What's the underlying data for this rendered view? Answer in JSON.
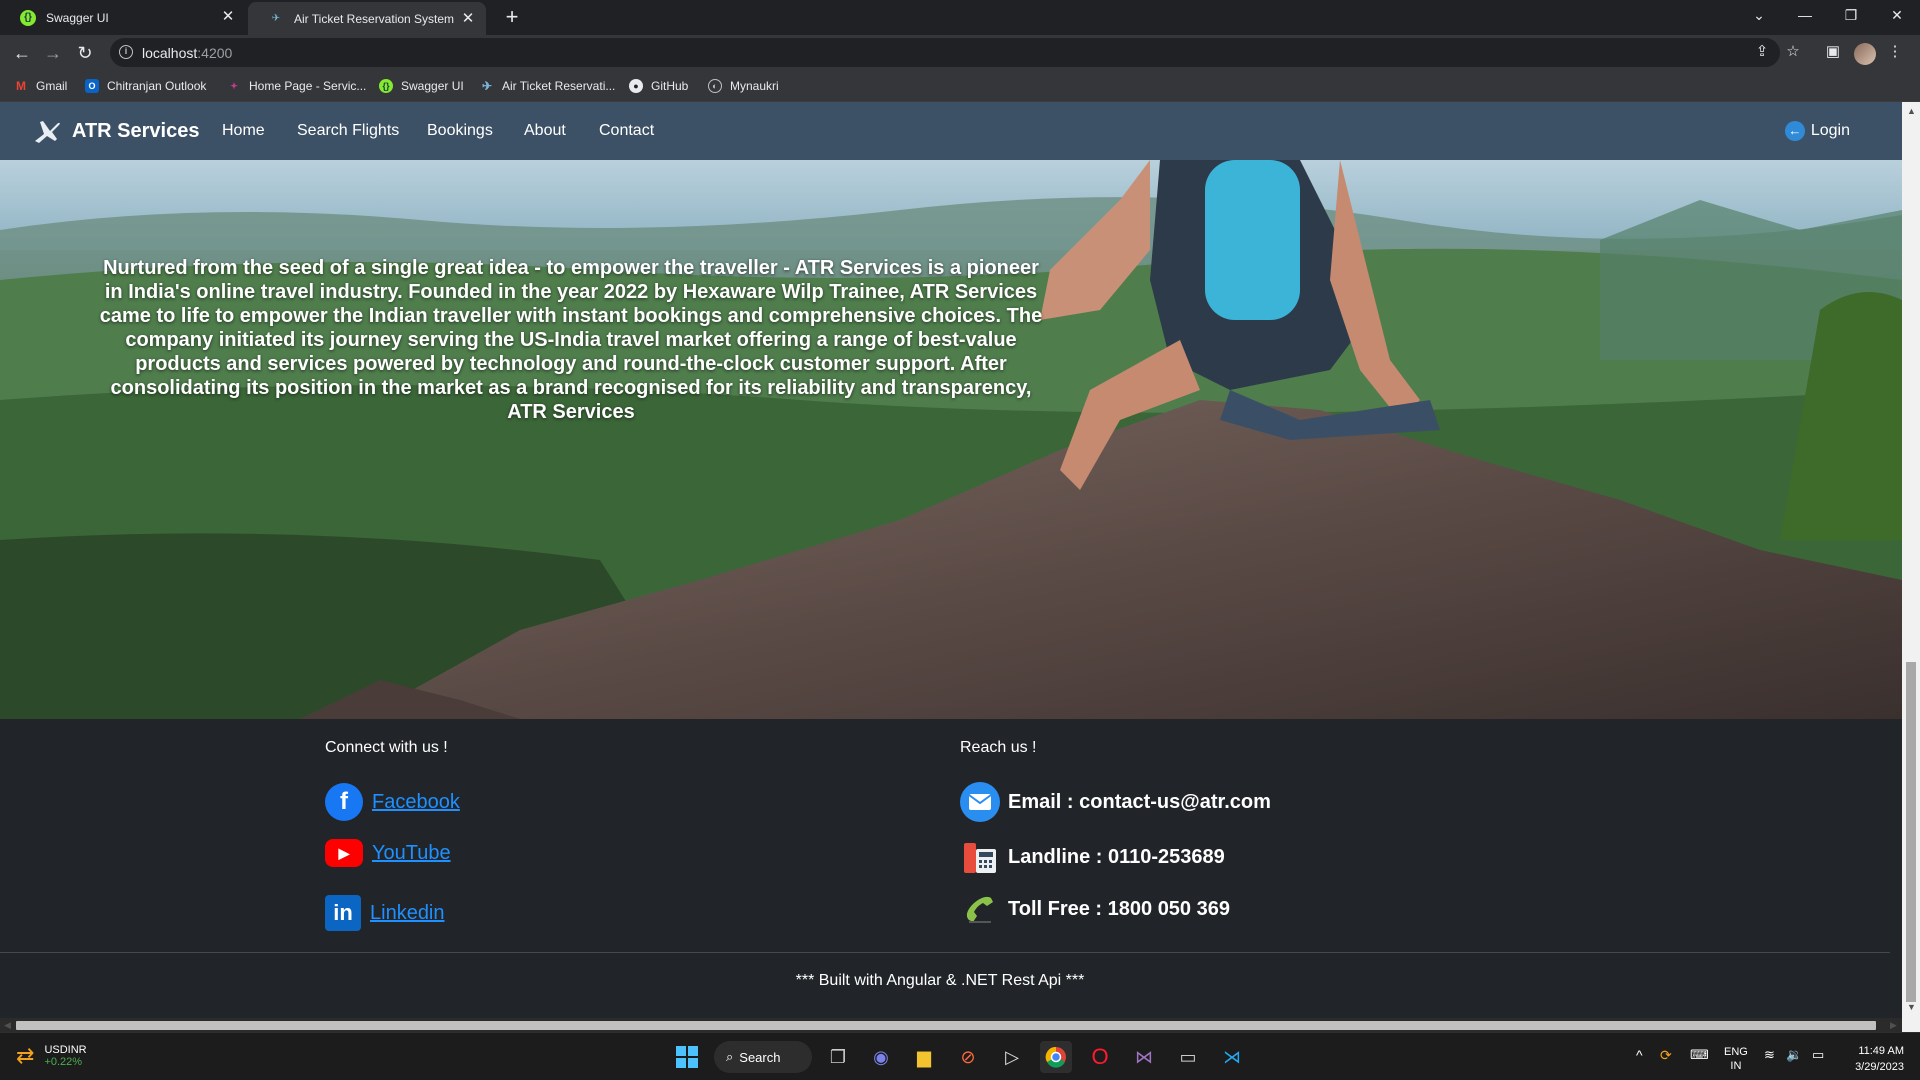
{
  "browser": {
    "tabs": [
      {
        "title": "Swagger UI"
      },
      {
        "title": "Air Ticket Reservation System"
      }
    ],
    "url_host": "localhost",
    "url_port": ":4200",
    "bookmarks": [
      "Gmail",
      "Chitranjan Outlook",
      "Home Page - Servic...",
      "Swagger UI",
      "Air Ticket Reservati...",
      "GitHub",
      "Mynaukri"
    ]
  },
  "navbar": {
    "brand": "ATR Services",
    "links": [
      "Home",
      "Search Flights",
      "Bookings",
      "About",
      "Contact"
    ],
    "login": "Login"
  },
  "hero": {
    "text": "Nurtured from the seed of a single great idea - to empower the traveller - ATR Services is a pioneer in India's online travel industry. Founded in the year 2022 by Hexaware Wilp Trainee, ATR Services came to life to empower the Indian traveller with instant bookings and comprehensive choices. The company initiated its journey serving the US-India travel market offering a range of best-value products and services powered by technology and round-the-clock customer support. After consolidating its position in the market as a brand recognised for its reliability and transparency, ATR Services"
  },
  "footer": {
    "connect_heading": "Connect with us !",
    "social": [
      {
        "label": "Facebook",
        "icon": "facebook-icon",
        "color": "#1877f2"
      },
      {
        "label": "YouTube",
        "icon": "youtube-icon",
        "color": "#ff0000"
      },
      {
        "label": "Linkedin",
        "icon": "linkedin-icon",
        "color": "#0a66c2"
      }
    ],
    "reach_heading": "Reach us !",
    "contacts": [
      {
        "label": "Email : contact-us@atr.com",
        "icon": "envelope-icon"
      },
      {
        "label": "Landline : 0110-253689",
        "icon": "telephone-icon"
      },
      {
        "label": "Toll Free : 1800 050 369",
        "icon": "phone-handset-icon"
      }
    ],
    "built_with": "*** Built with Angular & .NET Rest Api ***"
  },
  "taskbar": {
    "widget_title": "USDINR",
    "widget_value": "+0.22%",
    "search": "Search",
    "lang": "ENG",
    "region": "IN",
    "time": "11:49 AM",
    "date": "3/29/2023"
  }
}
